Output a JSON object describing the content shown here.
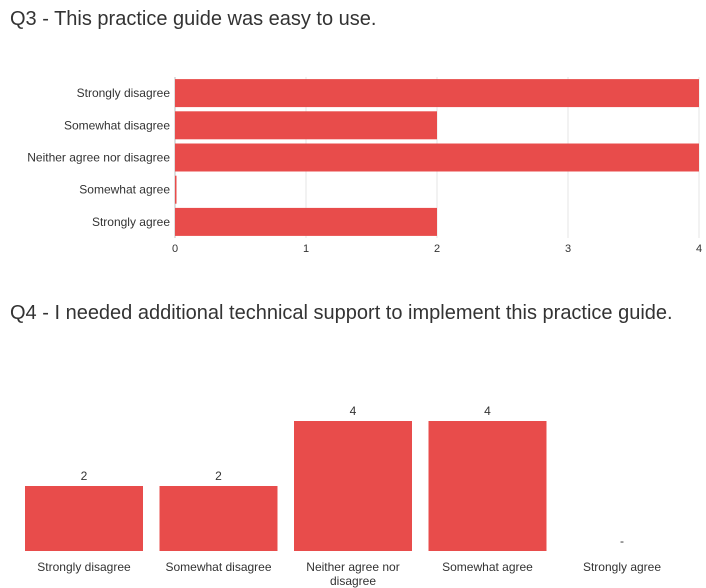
{
  "chart_data": [
    {
      "type": "bar",
      "orientation": "horizontal",
      "title": "Q3 - This practice guide was easy to use.",
      "categories": [
        "Strongly disagree",
        "Somewhat disagree",
        "Neither agree nor disagree",
        "Somewhat agree",
        "Strongly agree"
      ],
      "values": [
        4,
        2,
        4,
        0,
        2
      ],
      "xlim": [
        0,
        4
      ],
      "x_ticks": [
        "0",
        "1",
        "2",
        "3",
        "4"
      ],
      "grid": true,
      "color": "#e84c4b"
    },
    {
      "type": "bar",
      "orientation": "vertical",
      "title": "Q4 - I needed additional technical support to implement this practice guide.",
      "categories": [
        "Strongly disagree",
        "Somewhat disagree",
        "Neither agree nor disagree",
        "Somewhat agree",
        "Strongly agree"
      ],
      "values": [
        2,
        2,
        4,
        4,
        0
      ],
      "data_labels": [
        "2",
        "2",
        "4",
        "4",
        "-"
      ],
      "ylim": [
        0,
        4.5
      ],
      "grid": false,
      "color": "#e84c4b"
    }
  ]
}
